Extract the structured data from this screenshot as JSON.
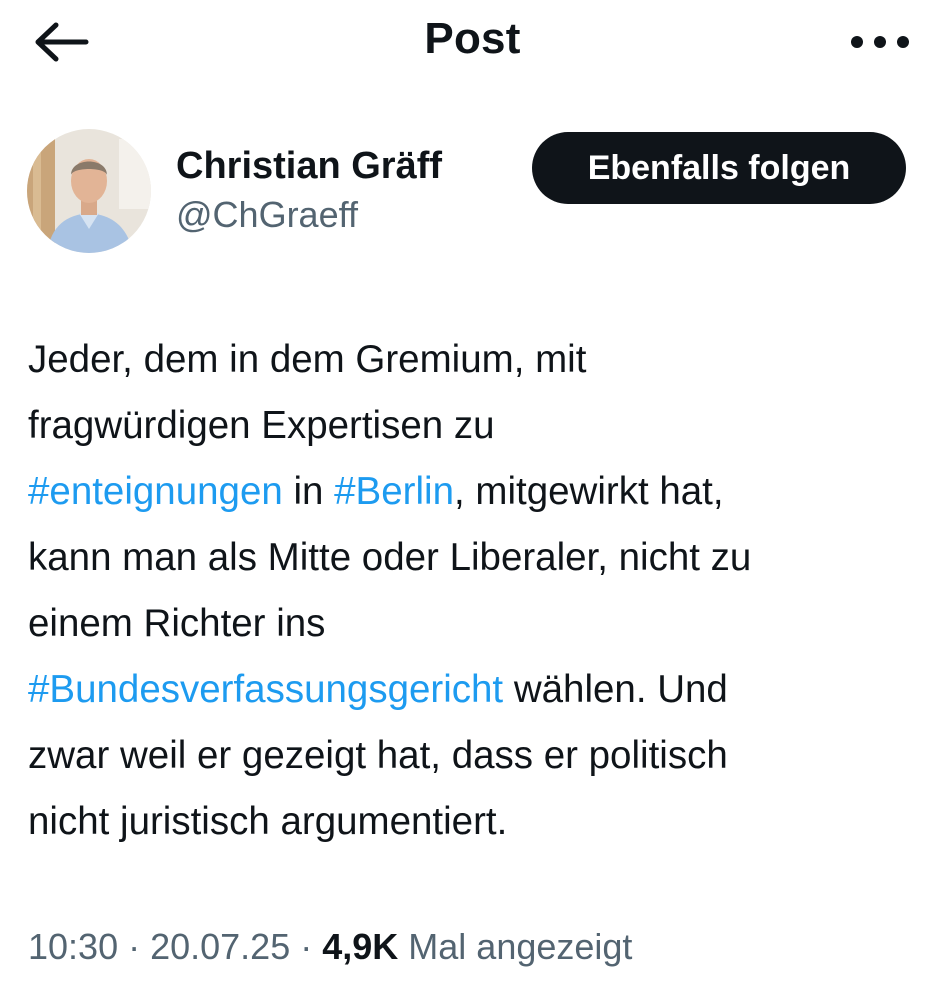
{
  "header": {
    "title": "Post",
    "back_icon": "arrow-left-icon",
    "more_icon": "more-horizontal-icon"
  },
  "author": {
    "name": "Christian Gräff",
    "handle": "@ChGraeff",
    "follow_label": "Ebenfalls folgen"
  },
  "post": {
    "lines": [
      [
        {
          "t": "Jeder, dem in dem Gremium, mit",
          "tag": false
        }
      ],
      [
        {
          "t": "fragwürdigen Expertisen zu",
          "tag": false
        }
      ],
      [
        {
          "t": "#enteignungen",
          "tag": true
        },
        {
          "t": " in ",
          "tag": false
        },
        {
          "t": "#Berlin",
          "tag": true
        },
        {
          "t": ", mitgewirkt hat,",
          "tag": false
        }
      ],
      [
        {
          "t": "kann man als Mitte oder Liberaler, nicht zu",
          "tag": false
        }
      ],
      [
        {
          "t": "einem Richter ins",
          "tag": false
        }
      ],
      [
        {
          "t": "#Bundesverfassungsgericht",
          "tag": true
        },
        {
          "t": " wählen. Und",
          "tag": false
        }
      ],
      [
        {
          "t": "zwar weil er gezeigt hat, dass er politisch",
          "tag": false
        }
      ],
      [
        {
          "t": "nicht juristisch argumentiert.",
          "tag": false
        }
      ]
    ]
  },
  "meta": {
    "time": "10:30",
    "date": "20.07.25",
    "separator": " · ",
    "views_count": "4,9K",
    "views_label": " Mal angezeigt"
  },
  "colors": {
    "text": "#0f1419",
    "secondary": "#536471",
    "hashtag": "#1d9bf0",
    "button_bg": "#0f1419"
  }
}
